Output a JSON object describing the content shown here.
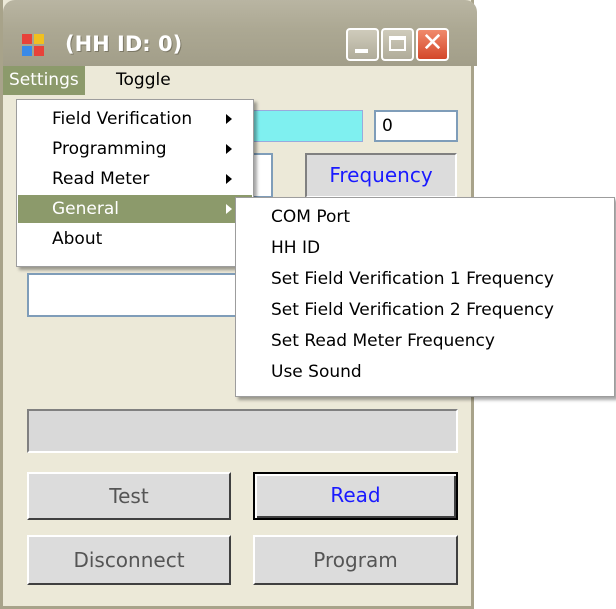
{
  "window": {
    "title": "(HH ID: 0)"
  },
  "menubar": {
    "items": [
      {
        "label": "Settings"
      },
      {
        "label": "Toggle"
      }
    ]
  },
  "settings_menu": {
    "items": [
      {
        "label": "Field Verification",
        "submenu": true
      },
      {
        "label": "Programming",
        "submenu": true
      },
      {
        "label": "Read Meter",
        "submenu": true
      },
      {
        "label": "General",
        "submenu": true,
        "highlighted": true
      },
      {
        "label": "About",
        "submenu": false
      }
    ]
  },
  "general_submenu": {
    "items": [
      {
        "label": "COM Port"
      },
      {
        "label": "HH ID"
      },
      {
        "label": "Set Field Verification 1 Frequency"
      },
      {
        "label": "Set Field Verification 2 Frequency"
      },
      {
        "label": "Set Read Meter Frequency"
      },
      {
        "label": "Use Sound"
      }
    ]
  },
  "form": {
    "count_value": "0",
    "frequency_label": "Frequency"
  },
  "buttons": {
    "test": "Test",
    "read": "Read",
    "disconnect": "Disconnect",
    "program": "Program"
  },
  "colors": {
    "menu_highlight": "#8c9a6b",
    "cyan_field": "#7ff0f0",
    "frequency_text": "#1a1aff"
  }
}
